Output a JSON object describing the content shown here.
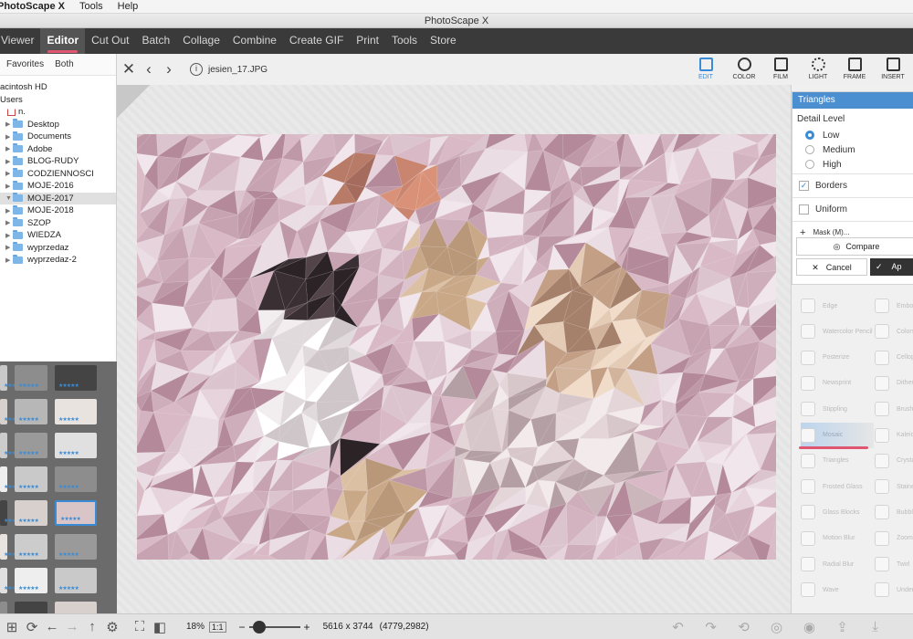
{
  "menubar": {
    "app_name": "PhotoScape X",
    "items": [
      "Tools",
      "Help"
    ]
  },
  "window": {
    "title": "PhotoScape X"
  },
  "nav": {
    "tabs": [
      "Viewer",
      "Editor",
      "Cut Out",
      "Batch",
      "Collage",
      "Combine",
      "Create GIF",
      "Print",
      "Tools",
      "Store"
    ],
    "active": "Editor"
  },
  "left_panel": {
    "favorites_label": "Favorites",
    "both_label": "Both",
    "tree": [
      {
        "label": "acintosh HD",
        "indent": 0,
        "type": "text"
      },
      {
        "label": "Users",
        "indent": 0,
        "type": "text"
      },
      {
        "label": "n.",
        "indent": 8,
        "type": "home"
      },
      {
        "label": "Desktop",
        "indent": 6,
        "type": "folder"
      },
      {
        "label": "Documents",
        "indent": 6,
        "type": "folder"
      },
      {
        "label": "Adobe",
        "indent": 6,
        "type": "folder"
      },
      {
        "label": "BLOG-RUDY",
        "indent": 6,
        "type": "folder"
      },
      {
        "label": "CODZIENNOSCI",
        "indent": 6,
        "type": "folder"
      },
      {
        "label": "MOJE-2016",
        "indent": 6,
        "type": "folder"
      },
      {
        "label": "MOJE-2017",
        "indent": 6,
        "type": "folder",
        "selected": true
      },
      {
        "label": "MOJE-2018",
        "indent": 6,
        "type": "folder"
      },
      {
        "label": "SZOP",
        "indent": 6,
        "type": "folder"
      },
      {
        "label": "WIEDZA",
        "indent": 6,
        "type": "folder"
      },
      {
        "label": "wyprzedaz",
        "indent": 6,
        "type": "folder"
      },
      {
        "label": "wyprzedaz-2",
        "indent": 6,
        "type": "folder"
      }
    ]
  },
  "editor": {
    "filename": "jesien_17.JPG",
    "tools": [
      "EDIT",
      "COLOR",
      "FILM",
      "LIGHT",
      "FRAME",
      "INSERT"
    ],
    "active_tool": "EDIT"
  },
  "bottom": {
    "zoom": "18%",
    "fit_label": "1:1",
    "dimensions": "5616 x 3744",
    "cursor": "(4779,2982)",
    "zoom_minus": "−",
    "zoom_plus": "+"
  },
  "triangles_panel": {
    "title": "Triangles",
    "detail_label": "Detail Level",
    "levels": [
      "Low",
      "Medium",
      "High"
    ],
    "selected_level": "Low",
    "borders_label": "Borders",
    "borders_checked": true,
    "uniform_label": "Uniform",
    "uniform_checked": false,
    "mask_label": "Mask (M)...",
    "compare_label": "Compare",
    "cancel_label": "Cancel",
    "apply_label": "Ap"
  },
  "filters": {
    "left": [
      "Edge",
      "Watercolor Pencil",
      "Posterize",
      "Newsprint",
      "Stippling",
      "Mosaic",
      "Triangles",
      "Frosted Glass",
      "Glass Blocks",
      "Motion Blur",
      "Radial Blur",
      "Wave"
    ],
    "right": [
      "Embo",
      "Colors",
      "Cellop",
      "Dither",
      "Brush",
      "Kaleid",
      "Crysta",
      "Stained",
      "Bubbl",
      "Zoom",
      "Twirl",
      "Under"
    ],
    "highlighted": "Mosaic"
  },
  "colors": {
    "accent": "#e05570",
    "blue": "#3a8bd6",
    "nav_bg": "#3a3a3a"
  }
}
